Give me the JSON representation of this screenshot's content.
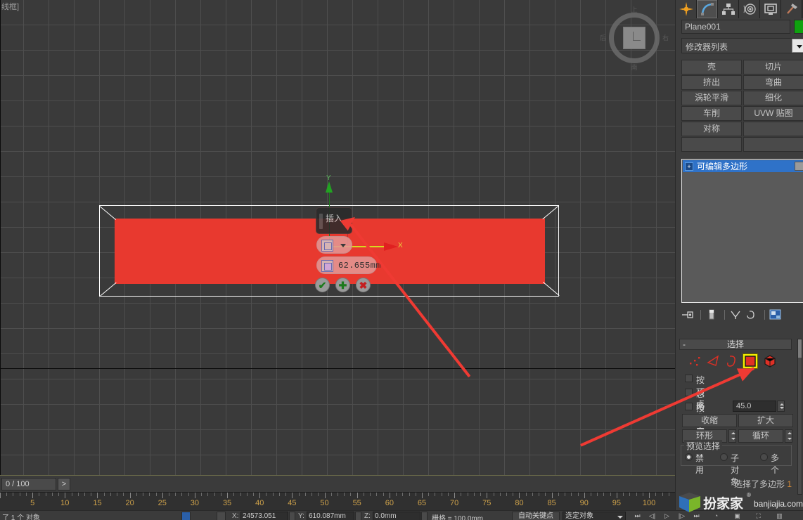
{
  "viewport": {
    "label": "线框]",
    "viewcube": {
      "top": "上",
      "bottom": "南",
      "left": "后",
      "right": "右"
    },
    "gizmo": {
      "x_label": "X",
      "y_label": "Y"
    },
    "caddy": {
      "title": "插入",
      "value": "62.655mm",
      "ok_icon": "✔",
      "apply_icon": "✚",
      "cancel_icon": "✖"
    }
  },
  "timebar": {
    "current": "0 / 100",
    "next_label": ">"
  },
  "ruler": {
    "labels": [
      "5",
      "10",
      "15",
      "20",
      "25",
      "30",
      "35",
      "40",
      "45",
      "50",
      "55",
      "60",
      "65",
      "70",
      "75",
      "80",
      "85",
      "90",
      "95",
      "100"
    ]
  },
  "statusbar": {
    "selection": "了 1 个 对象",
    "x_label": "X:",
    "x_value": "24573.051",
    "y_label": "Y:",
    "y_value": "610.087mm",
    "z_label": "Z:",
    "z_value": "0.0mm",
    "grid_label": "栅格 = 100.0mm",
    "autokey": "自动关键点",
    "ref_coord": "选定对象"
  },
  "panel": {
    "tabs": [
      {
        "name": "create-tab",
        "icon": "star-icon",
        "active": false
      },
      {
        "name": "modify-tab",
        "icon": "curve-icon",
        "active": true
      },
      {
        "name": "hierarchy-tab",
        "icon": "hierarchy-icon",
        "active": false
      },
      {
        "name": "motion-tab",
        "icon": "wheel-icon",
        "active": false
      },
      {
        "name": "display-tab",
        "icon": "monitor-icon",
        "active": false
      },
      {
        "name": "utilities-tab",
        "icon": "hammer-icon",
        "active": false
      }
    ],
    "object_name": "Plane001",
    "object_color": "#0fa20f",
    "modifier_list_label": "修改器列表",
    "modifier_buttons": [
      "壳",
      "切片",
      "挤出",
      "弯曲",
      "涡轮平滑",
      "细化",
      "车削",
      "UVW 贴图",
      "对称",
      "",
      "",
      ""
    ],
    "stack": {
      "items": [
        {
          "label": "可编辑多边形",
          "expand": "+"
        }
      ]
    },
    "stack_tools": [
      "pin-stack-icon",
      "show-end-result-icon",
      "make-unique-icon",
      "remove-modifier-icon",
      "configure-sets-icon"
    ],
    "selection_rollout": {
      "header": "选择",
      "collapse": "-",
      "sub_objects": [
        {
          "name": "vertex",
          "label": "顶点"
        },
        {
          "name": "edge",
          "label": "边"
        },
        {
          "name": "border",
          "label": "边界"
        },
        {
          "name": "polygon",
          "label": "多边形",
          "selected": true
        },
        {
          "name": "element",
          "label": "元素"
        }
      ],
      "checkboxes": [
        {
          "label": "按顶点",
          "checked": false
        },
        {
          "label": "忽略背面",
          "checked": false
        },
        {
          "label": "按角度:",
          "checked": false
        }
      ],
      "angle_value": "45.0",
      "buttons": {
        "shrink": "收缩",
        "grow": "扩大",
        "ring": "环形",
        "loop": "循环"
      },
      "preview": {
        "title": "预览选择",
        "options": [
          {
            "label": "禁用",
            "selected": true
          },
          {
            "label": "子对象",
            "selected": false
          },
          {
            "label": "多个",
            "selected": false
          }
        ]
      },
      "status": "选择了多边形",
      "status_count": "1"
    }
  },
  "watermark": {
    "brand": "扮家家",
    "domain": "banjiajia.com",
    "reg": "®"
  }
}
